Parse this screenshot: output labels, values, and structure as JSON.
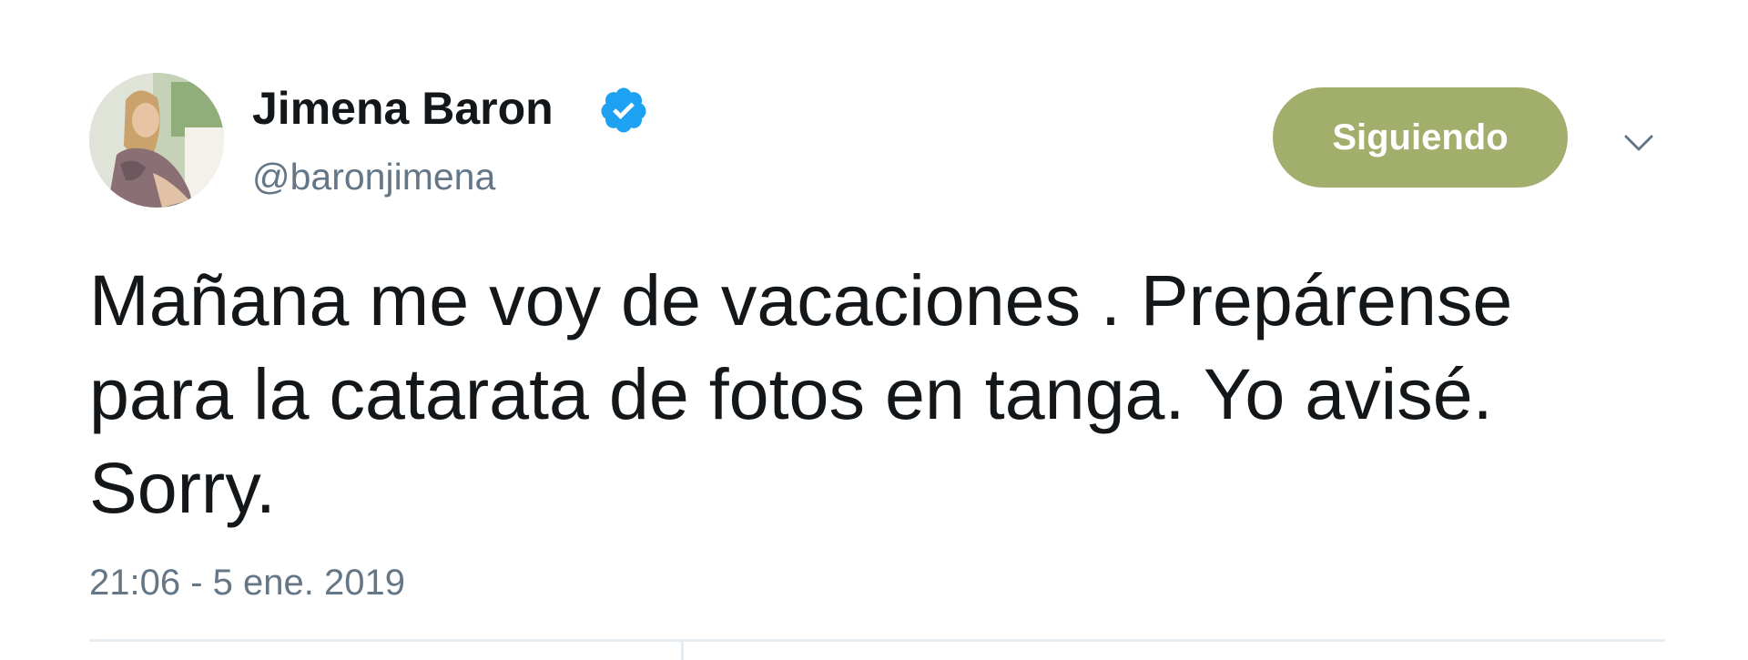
{
  "tweet": {
    "author": {
      "display_name": "Jimena Baron",
      "handle": "@baronjimena",
      "verified_icon": "verified-badge-icon",
      "avatar_icon": "profile-photo"
    },
    "follow_button_label": "Siguiendo",
    "menu_icon": "chevron-down-icon",
    "text_lines": [
      "Mañana me voy de vacaciones . Prepárense",
      "para la catarata de fotos en tanga. Yo avisé.",
      "Sorry."
    ],
    "timestamp": "21:06 - 5 ene. 2019"
  },
  "colors": {
    "follow_button": "#a2ae6b",
    "verified_badge": "#1da1f2",
    "secondary_text": "#657786",
    "primary_text": "#14171a",
    "divider": "#e6ecf0"
  }
}
